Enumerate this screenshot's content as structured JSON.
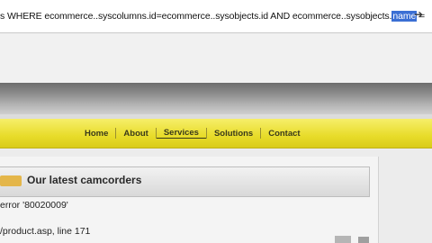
{
  "address_bar": {
    "url_prefix": "s WHERE ecommerce..syscolumns.id=ecommerce..sysobjects.id AND ecommerce..sysobjects.",
    "url_selected": "name",
    "url_suffix": " =",
    "go_icon": "arrow-right-icon"
  },
  "nav": {
    "items": [
      "Home",
      "About",
      "Services",
      "Solutions",
      "Contact"
    ],
    "active": "Services"
  },
  "section": {
    "title": "Our latest camcorders",
    "icon": "folder-icon"
  },
  "error": {
    "line1": "error '80020009'",
    "line2": "/product.asp, line 171"
  },
  "colors": {
    "nav_yellow": "#e8dc2a",
    "selection": "#3b6fd4"
  }
}
